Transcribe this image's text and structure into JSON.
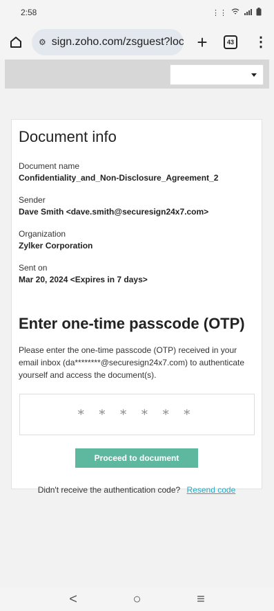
{
  "status_bar": {
    "time": "2:58",
    "icons": [
      "vibrate-icon",
      "wifi-icon",
      "signal-icon",
      "battery-icon"
    ]
  },
  "browser": {
    "url": "sign.zoho.com/zsguest?loc",
    "tab_count": "43"
  },
  "document_info": {
    "heading": "Document info",
    "fields": [
      {
        "label": "Document name",
        "value": "Confidentiality_and_Non-Disclosure_Agreement_2"
      },
      {
        "label": "Sender",
        "value": "Dave Smith <dave.smith@securesign24x7.com>"
      },
      {
        "label": "Organization",
        "value": "Zylker Corporation"
      },
      {
        "label": "Sent on",
        "value": "Mar 20, 2024 <Expires in 7 days>"
      }
    ]
  },
  "otp": {
    "heading": "Enter one-time passcode (OTP)",
    "description": "Please enter the one-time passcode (OTP) received in your email inbox (da********@securesign24x7.com) to authenticate yourself and access the document(s).",
    "placeholder": "* * * * * *",
    "button_label": "Proceed to document",
    "resend_prompt": "Didn't receive the authentication code?",
    "resend_link": "Resend code"
  },
  "colors": {
    "button": "#5eb8a0",
    "link": "#2aa7c0",
    "band": "#d7d7d7"
  },
  "nav": {
    "back": "<",
    "home": "○",
    "recents": "≡"
  }
}
